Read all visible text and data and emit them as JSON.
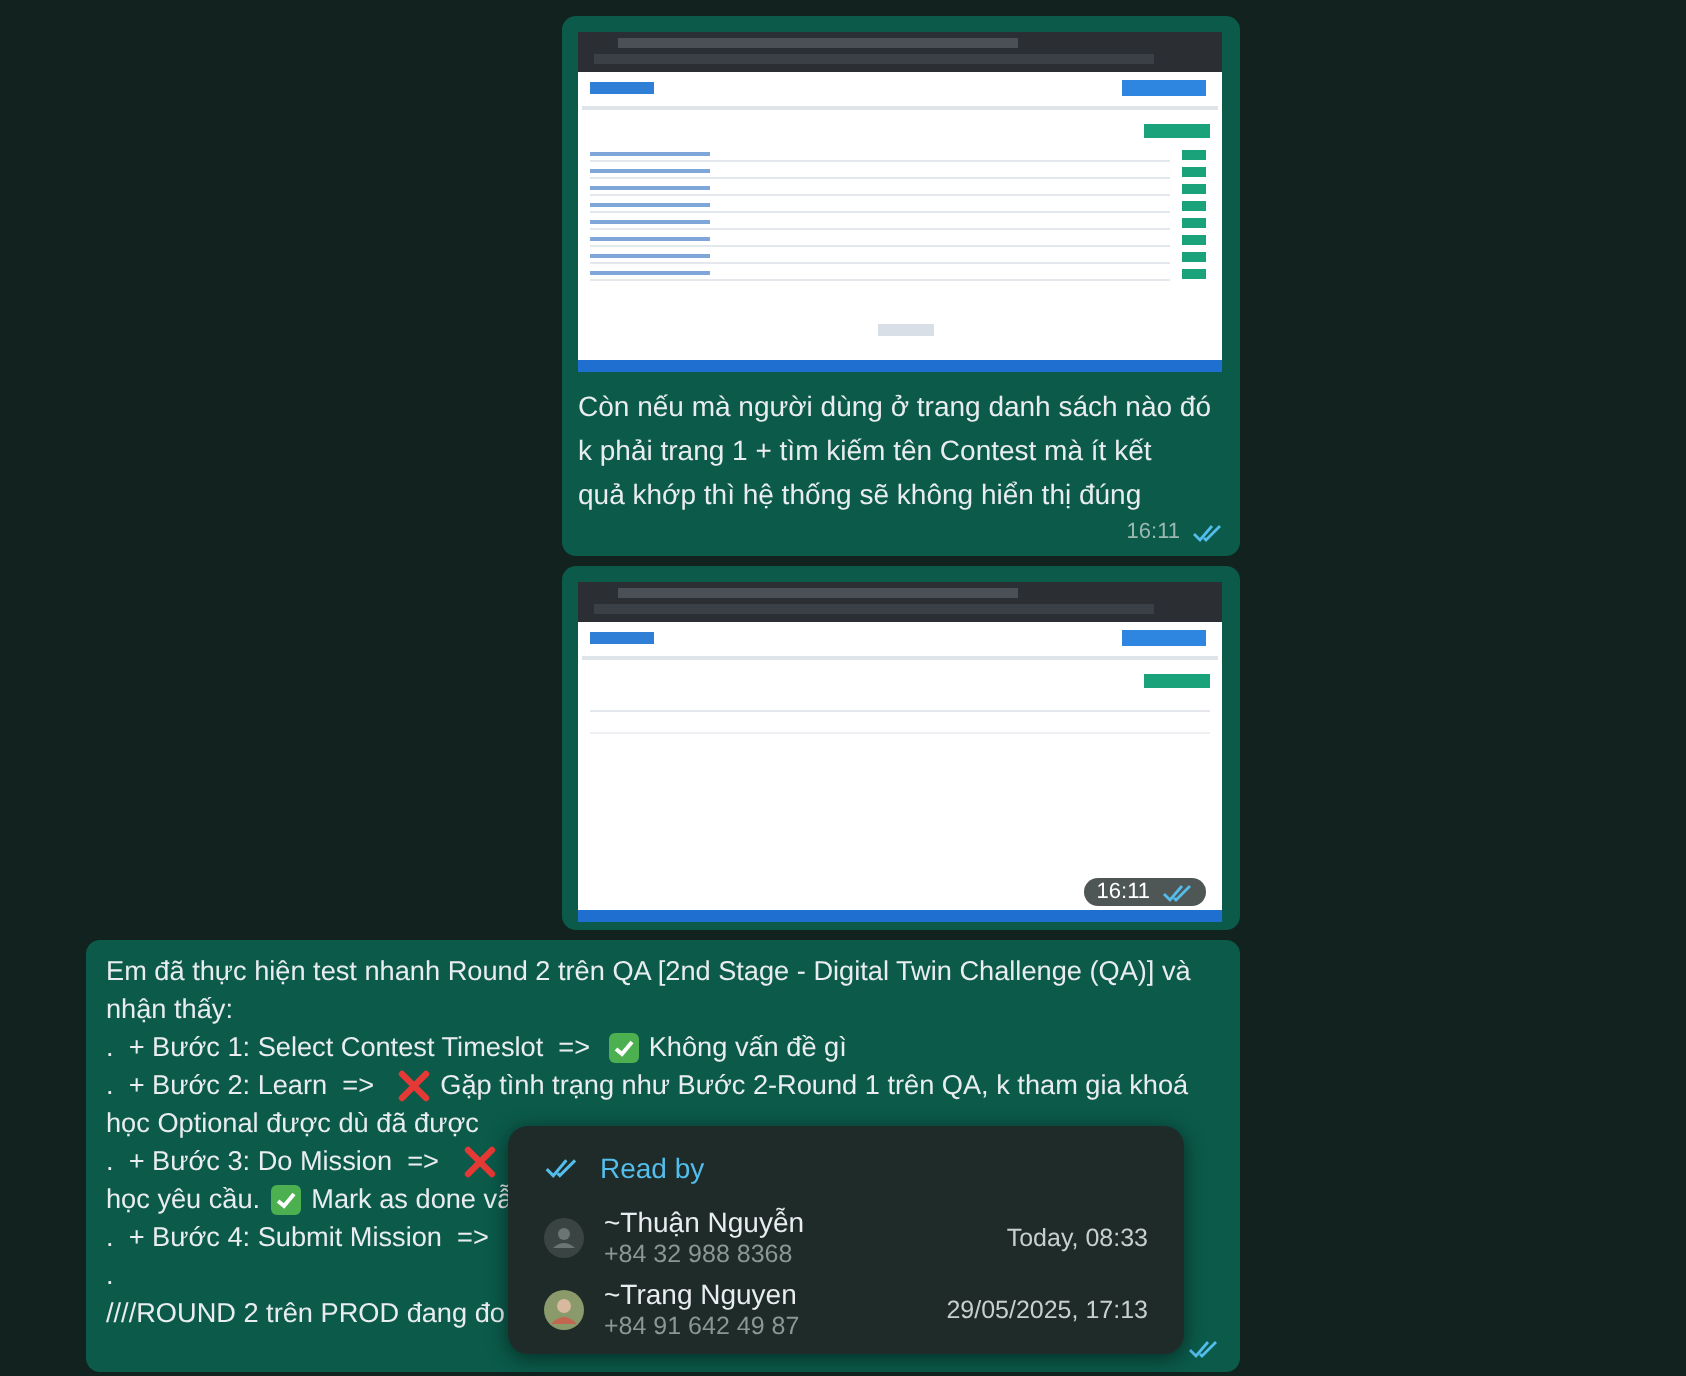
{
  "messages": [
    {
      "caption": [
        "Còn nếu mà người dùng ở trang danh sách nào đó",
        "k phải trang 1 + tìm kiếm tên Contest mà ít kết",
        "quả khớp thì hệ thống sẽ không hiển thị đúng"
      ],
      "time": "16:11",
      "read": true
    },
    {
      "time": "16:11",
      "read": true
    },
    {
      "kind": "text",
      "lines": [
        [
          {
            "kind": "text",
            "text": "Em đã thực hiện test nhanh Round 2 trên QA [2nd Stage - Digital Twin Challenge (QA)] và"
          }
        ],
        [
          {
            "kind": "text",
            "text": "nhận thấy:"
          }
        ],
        [
          {
            "kind": "text",
            "text": ".  + Bước 1: Select Contest Timeslot  =>  "
          },
          {
            "kind": "check"
          },
          {
            "kind": "text",
            "text": " Không vấn đề gì"
          }
        ],
        [
          {
            "kind": "text",
            "text": ".  + Bước 2: Learn  =>   "
          },
          {
            "kind": "cross"
          },
          {
            "kind": "text",
            "text": " Gặp tình trạng như Bước 2-Round 1 trên QA, k tham gia khoá"
          }
        ],
        [
          {
            "kind": "text",
            "text": "học Optional được dù đã được"
          }
        ],
        [
          {
            "kind": "text",
            "text": ".  + Bước 3: Do Mission  =>   "
          },
          {
            "kind": "cross"
          }
        ],
        [
          {
            "kind": "text",
            "text": "học yêu cầu. "
          },
          {
            "kind": "check"
          },
          {
            "kind": "text",
            "text": " Mark as done vẫ"
          }
        ],
        [
          {
            "kind": "text",
            "text": ".  + Bước 4: Submit Mission  =>"
          }
        ],
        [
          {
            "kind": "text",
            "text": "."
          }
        ],
        [
          {
            "kind": "text",
            "text": "////ROUND 2 trên PROD đang đo"
          }
        ]
      ],
      "read": true
    }
  ],
  "read_by": {
    "title": "Read by",
    "readers": [
      {
        "name": "~Thuận Nguyễn",
        "phone": "+84 32 988 8368",
        "time": "Today, 08:33",
        "kind": "placeholder"
      },
      {
        "name": "~Trang Nguyen",
        "phone": "+84 91 642 49 87",
        "time": "29/05/2025, 17:13"
      }
    ]
  }
}
